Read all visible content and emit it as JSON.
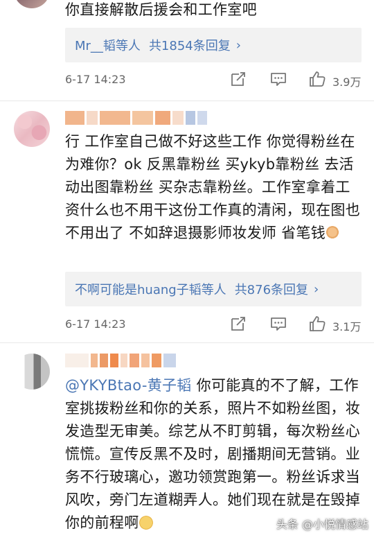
{
  "comments": [
    {
      "text": "你直接解散后援会和工作室吧",
      "reply_users": "Mr__韬",
      "reply_etc": "等人",
      "reply_count": "共1854条回复",
      "time": "6-17 14:23",
      "likes": "3.9万"
    },
    {
      "text": "行 工作室自己做不好这些工作 你觉得粉丝在为难你？ok 反黑靠粉丝 买ykyb靠粉丝 去活动出图靠粉丝 买杂志靠粉丝。工作室拿着工资什么也不用干这份工作真的清闲，现在图也不用出了 不如辞退摄影师妆发师 省笔钱",
      "emoji": "thumbs-up",
      "reply_users": "不啊可能是huang子韬",
      "reply_etc": "等人",
      "reply_count": "共876条回复",
      "time": "6-17 14:23",
      "likes": "3.1万"
    },
    {
      "mention": "@YKYBtao-黄子韬",
      "text": " 你可能真的不了解，工作室挑拨粉丝和你的关系，照片不如粉丝图，妆发造型无审美。综艺从不盯剪辑，每次粉丝心慌慌。宣传反黑不及时，剧播期间无营销。业务不行玻璃心，邀功领赏跑第一。粉丝诉求当风吹，旁门左道糊弄人。她们现在就是在毁掉你的前程啊",
      "emoji": "sad-face"
    }
  ],
  "reply_chevron": "›",
  "watermark": "头条 @小悦情感站",
  "colors": {
    "link": "#4a76b4",
    "reply_bg": "#f2f2f2",
    "meta": "#666666"
  }
}
